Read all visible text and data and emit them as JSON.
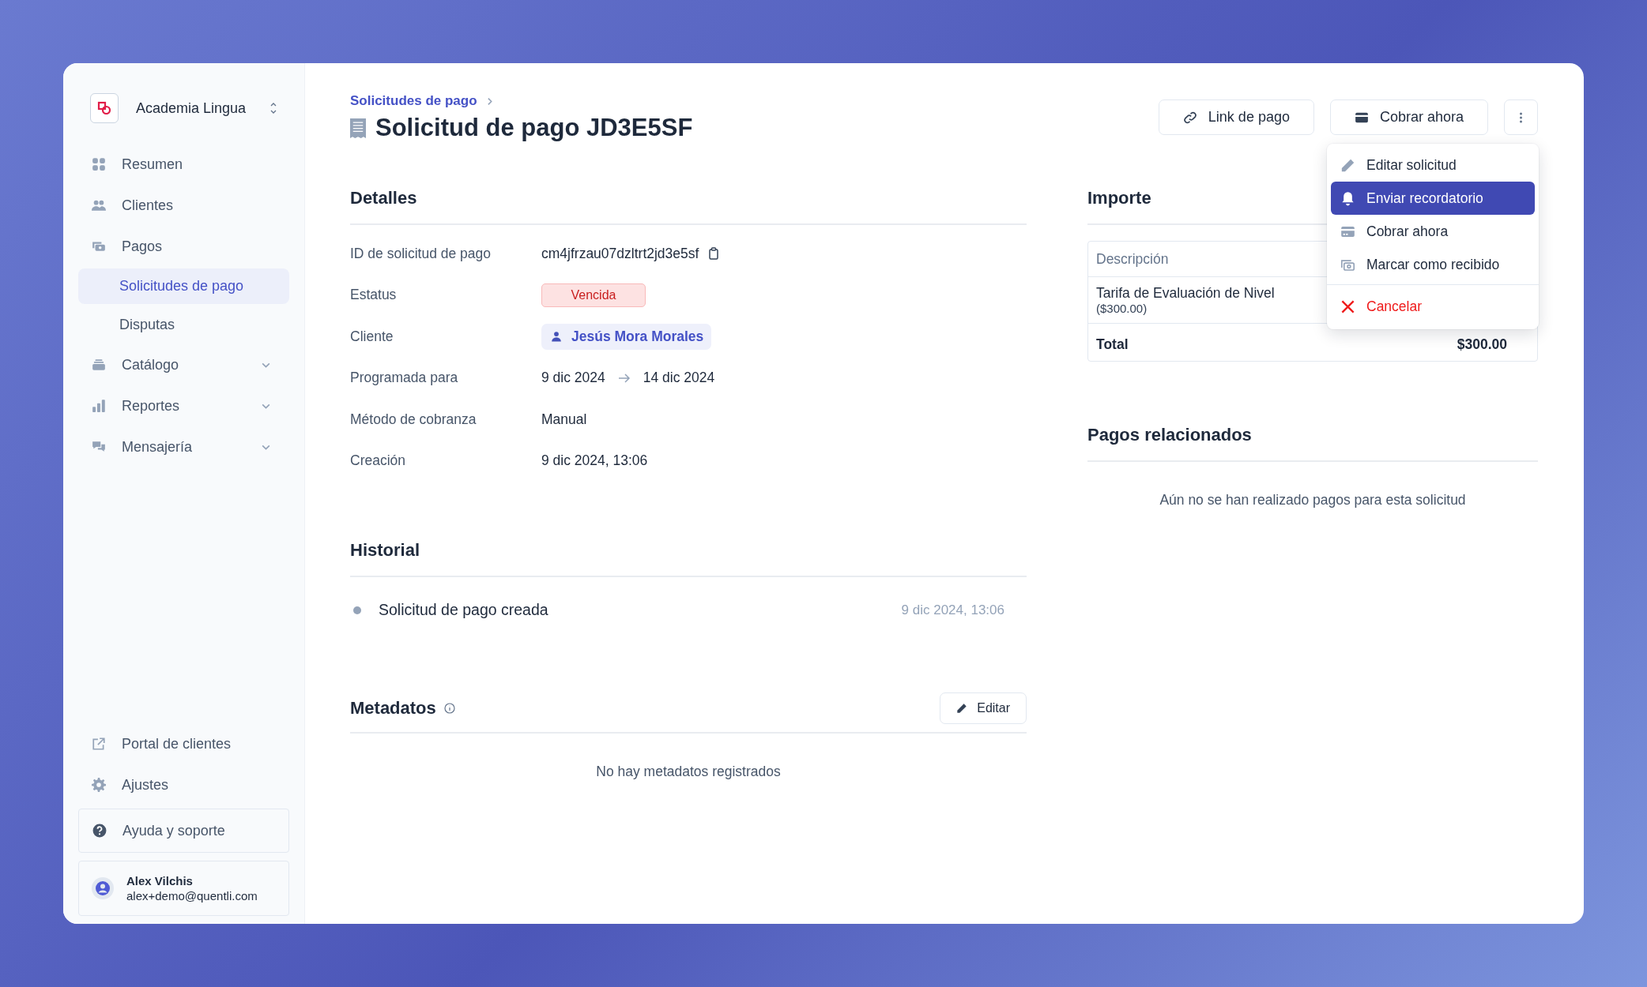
{
  "workspace": {
    "name": "Academia Lingua"
  },
  "sidebar": {
    "items": [
      {
        "label": "Resumen",
        "kind": "link"
      },
      {
        "label": "Clientes",
        "kind": "link"
      },
      {
        "label": "Pagos",
        "kind": "section",
        "children": [
          {
            "label": "Solicitudes de pago",
            "selected": true
          },
          {
            "label": "Disputas",
            "selected": false
          }
        ]
      },
      {
        "label": "Catálogo",
        "kind": "group",
        "expanded": false
      },
      {
        "label": "Reportes",
        "kind": "group",
        "expanded": false
      },
      {
        "label": "Mensajería",
        "kind": "group",
        "expanded": false
      }
    ],
    "footer_links": [
      "Portal de clientes",
      "Ajustes"
    ],
    "help": "Ayuda y soporte",
    "user": {
      "name": "Alex Vilchis",
      "email": "alex+demo@quentli.com"
    }
  },
  "breadcrumb": [
    "Solicitudes de pago"
  ],
  "title": "Solicitud de pago JD3E5SF",
  "actions": [
    "Link de pago",
    "Cobrar ahora"
  ],
  "menu": {
    "items": [
      {
        "label": "Editar solicitud",
        "kind": "item",
        "selected": false
      },
      {
        "label": "Enviar recordatorio",
        "kind": "item",
        "selected": true
      },
      {
        "label": "Cobrar ahora",
        "kind": "item",
        "selected": false
      },
      {
        "label": "Marcar como recibido",
        "kind": "item",
        "selected": false
      },
      {
        "label": "Cancelar",
        "kind": "danger",
        "selected": false
      }
    ]
  },
  "details": {
    "heading": "Detalles",
    "rows": [
      {
        "label": "ID de solicitud de pago",
        "kind": "id",
        "value": "cm4jfrzau07dzltrt2jd3e5sf"
      },
      {
        "label": "Estatus",
        "kind": "badge",
        "value": "Vencida"
      },
      {
        "label": "Cliente",
        "kind": "client",
        "value": "Jesús Mora Morales"
      },
      {
        "label": "Programada para",
        "kind": "range",
        "from": "9 dic 2024",
        "to": "14 dic 2024"
      },
      {
        "label": "Método de cobranza",
        "kind": "text",
        "value": "Manual"
      },
      {
        "label": "Creación",
        "kind": "text",
        "value": "9 dic 2024, 13:06"
      }
    ]
  },
  "history": {
    "heading": "Historial",
    "events": [
      {
        "event": "Solicitud de pago creada",
        "time": "9 dic 2024, 13:06"
      }
    ]
  },
  "metadata": {
    "heading": "Metadatos",
    "edit_label": "Editar",
    "empty": "No hay metadatos registrados"
  },
  "amount": {
    "heading": "Importe",
    "columns": [
      "Descripción"
    ],
    "rows": [
      {
        "description": "Tarifa de Evaluación de Nivel",
        "note": "($300.00)"
      }
    ],
    "total": {
      "label": "Total",
      "value": "$300.00"
    }
  },
  "related": {
    "heading": "Pagos relacionados",
    "empty": "Aún no se han realizado pagos para esta solicitud"
  }
}
